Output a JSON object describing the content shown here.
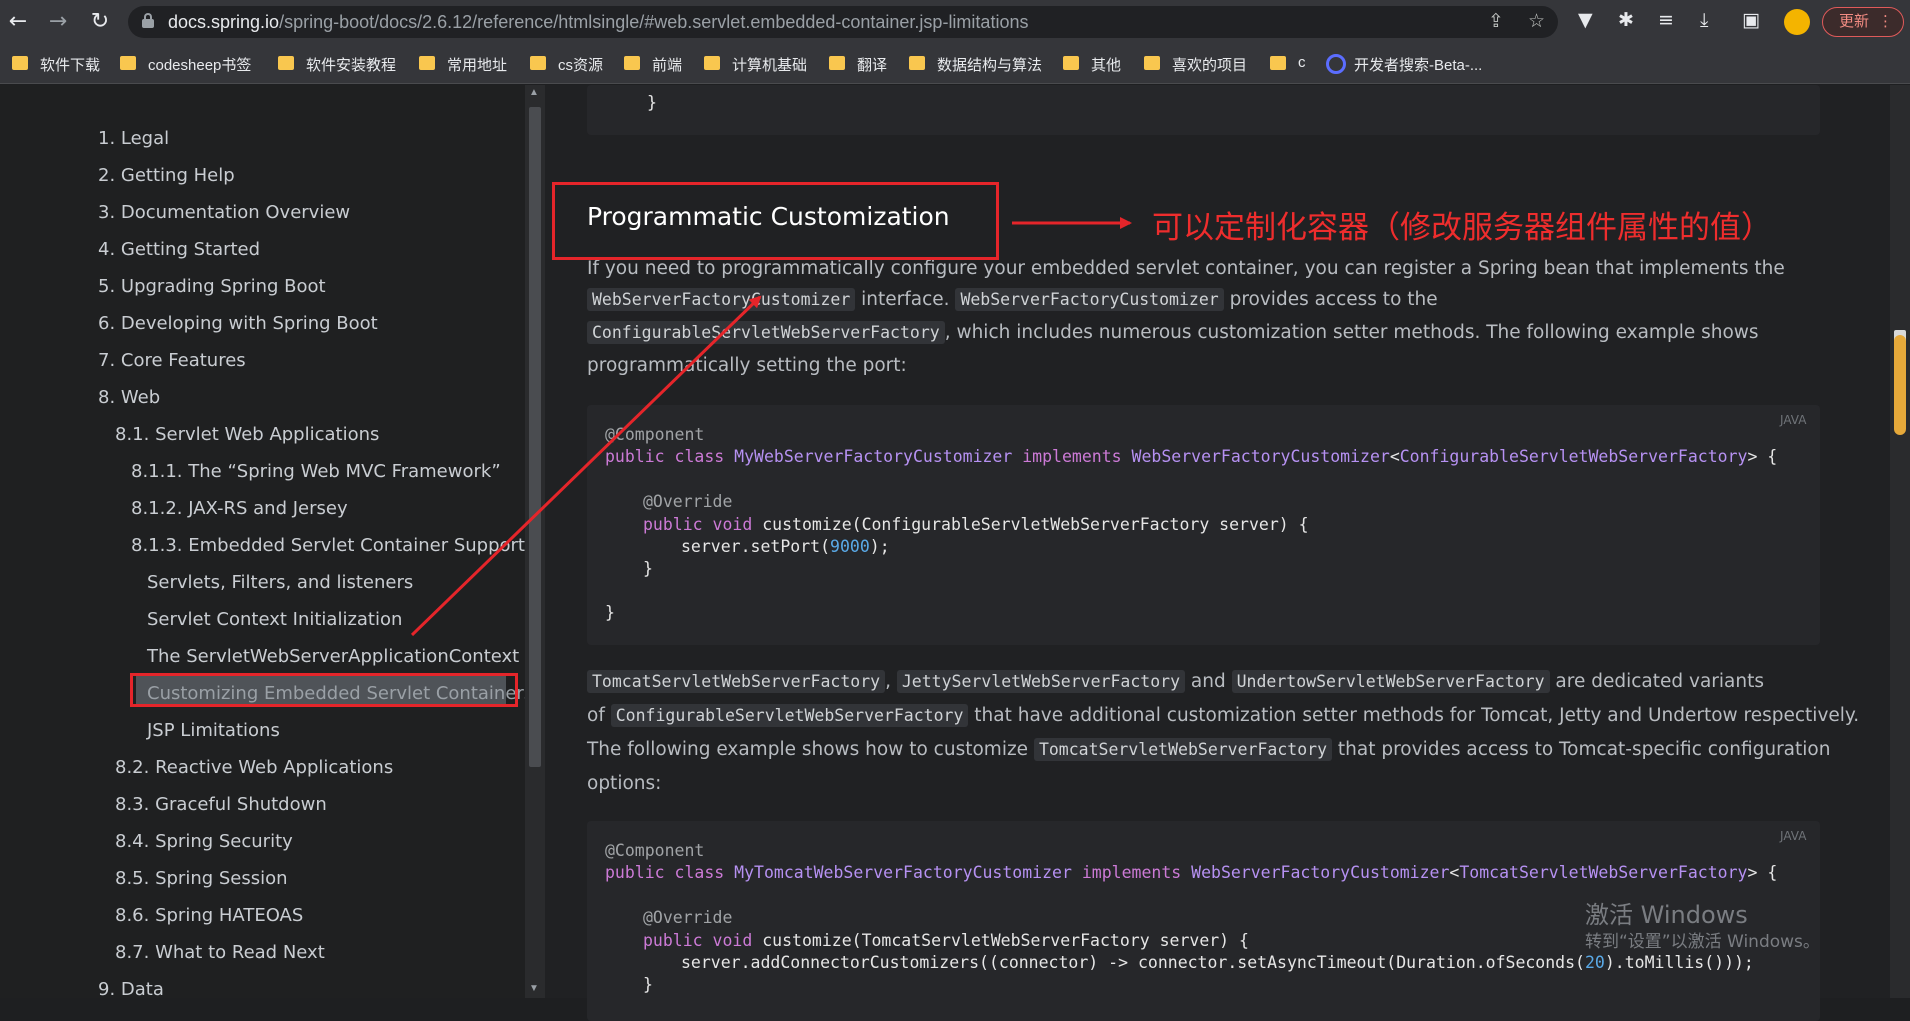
{
  "browser": {
    "url_host": "docs.spring.io",
    "url_path": "/spring-boot/docs/2.6.12/reference/htmlsingle/#web.servlet.embedded-container.jsp-limitations",
    "update_label": "更新",
    "back_icon": "←",
    "forward_icon": "→",
    "reload_icon": "↻",
    "share_icon": "⇪",
    "star_icon": "☆",
    "ext_icons": [
      "▼",
      "✱",
      "≡",
      "⤓",
      "▣"
    ],
    "menu_icon": "⋮"
  },
  "bookmarks": [
    "软件下载",
    "codesheep书签",
    "软件安装教程",
    "常用地址",
    "cs资源",
    "前端",
    "计算机基础",
    "翻译",
    "数据结构与算法",
    "其他",
    "喜欢的项目",
    "c",
    "开发者搜索-Beta-..."
  ],
  "toc": [
    "1. Legal",
    "2. Getting Help",
    "3. Documentation Overview",
    "4. Getting Started",
    "5. Upgrading Spring Boot",
    "6. Developing with Spring Boot",
    "7. Core Features",
    "8. Web",
    "8.1. Servlet Web Applications",
    "8.1.1. The “Spring Web MVC Framework”",
    "8.1.2. JAX-RS and Jersey",
    "8.1.3. Embedded Servlet Container Support",
    "Servlets, Filters, and listeners",
    "Servlet Context Initialization",
    "The ServletWebServerApplicationContext",
    "Customizing Embedded Servlet Containers",
    "JSP Limitations",
    "8.2. Reactive Web Applications",
    "8.3. Graceful Shutdown",
    "8.4. Spring Security",
    "8.5. Spring Session",
    "8.6. Spring HATEOAS",
    "8.7. What to Read Next",
    "9. Data"
  ],
  "toc_active": "Customizing Embedded Servlet Containers",
  "content": {
    "top_code_brace": "}",
    "section_title": "Programmatic Customization",
    "annotation": "可以定制化容器（修改服务器组件属性的值）",
    "p1": {
      "t1": "If you need to programmatically configure your embedded servlet container, you can register a Spring bean that implements the",
      "c1": "WebServerFactoryCustomizer",
      "t2": " interface. ",
      "c2": "WebServerFactoryCustomizer",
      "t3": " provides access to the",
      "c3": "ConfigurableServletWebServerFactory",
      "t4": ", which includes numerous customization setter methods. The following example shows",
      "t5": "programmatically setting the port:"
    },
    "code1": {
      "lang": "JAVA",
      "l1_ann": "@Component",
      "l2_kw1": "public",
      "l2_kw2": "class",
      "l2_cls": "MyWebServerFactoryCustomizer",
      "l2_kw3": "implements",
      "l2_if": "WebServerFactoryCustomizer",
      "l2_gen": "ConfigurableServletWebServerFactory",
      "l2_end": "> {",
      "l4_ann": "@Override",
      "l5_kw1": "public",
      "l5_kw2": "void",
      "l5_rest": " customize(ConfigurableServletWebServerFactory server) {",
      "l6_pre": "server.setPort(",
      "l6_num": "9000",
      "l6_post": ");",
      "l7": "}",
      "l9": "}"
    },
    "p2": {
      "c1": "TomcatServletWebServerFactory",
      "t1": ", ",
      "c2": "JettyServletWebServerFactory",
      "t2": " and ",
      "c3": "UndertowServletWebServerFactory",
      "t3": " are dedicated variants",
      "t4": "of ",
      "c4": "ConfigurableServletWebServerFactory",
      "t5": " that have additional customization setter methods for Tomcat, Jetty and Undertow respectively.",
      "t6": "The following example shows how to customize ",
      "c5": "TomcatServletWebServerFactory",
      "t7": " that provides access to Tomcat-specific configuration",
      "t8": "options:"
    },
    "code2": {
      "lang": "JAVA",
      "l1_ann": "@Component",
      "l2_kw1": "public",
      "l2_kw2": "class",
      "l2_cls": "MyTomcatWebServerFactoryCustomizer",
      "l2_kw3": "implements",
      "l2_if": "WebServerFactoryCustomizer",
      "l2_gen": "TomcatServletWebServerFactory",
      "l2_end": "> {",
      "l4_ann": "@Override",
      "l5_kw1": "public",
      "l5_kw2": "void",
      "l5_rest": " customize(TomcatServletWebServerFactory server) {",
      "l6_pre": "server.addConnectorCustomizers((connector) -> connector.setAsyncTimeout(Duration.ofSeconds(",
      "l6_num": "20",
      "l6_post": ").toMillis()));",
      "l7": "}"
    }
  },
  "watermark": {
    "line1": "激活 Windows",
    "line2": "转到“设置”以激活 Windows。"
  }
}
